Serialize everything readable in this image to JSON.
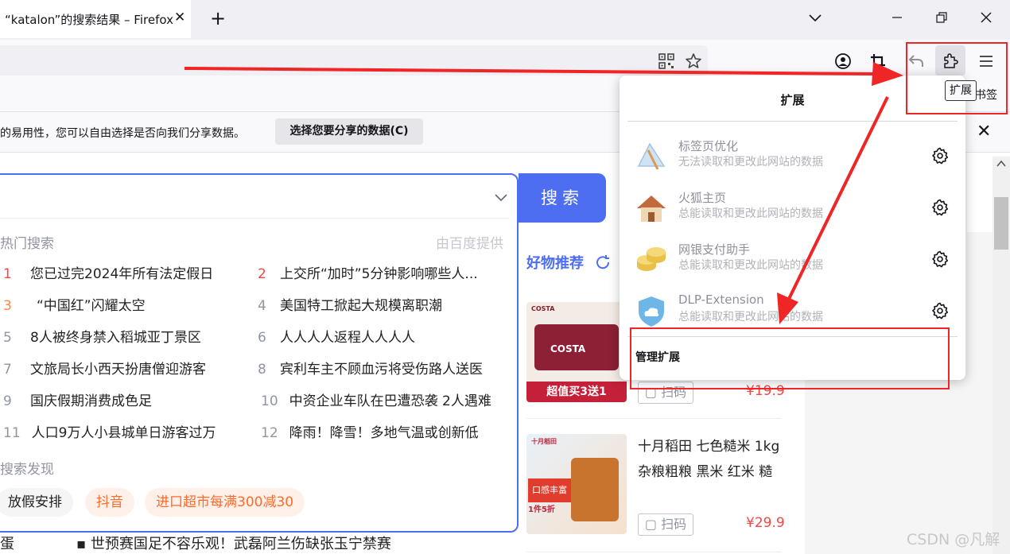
{
  "window": {
    "tab_title": "“katalon”的搜索结果 – Firefox",
    "tab_close": "✕",
    "new_tab": "+"
  },
  "notification": {
    "text": "的易用性，您可以自由选择是否向我们分享数据。",
    "button": "选择您要分享的数据(C)",
    "close": "✕"
  },
  "tooltip": "扩展",
  "bookmarks_label": "书签",
  "extensions_panel": {
    "title": "扩展",
    "items": [
      {
        "name": "标签页优化",
        "permission": "无法读取和更改此网站的数据"
      },
      {
        "name": "火狐主页",
        "permission": "总能读取和更改此网站的数据"
      },
      {
        "name": "网银支付助手",
        "permission": "总能读取和更改此网站的数据"
      },
      {
        "name": "DLP-Extension",
        "permission": "总能读取和更改此网站的数据"
      }
    ],
    "manage": "管理扩展"
  },
  "search": {
    "button": "搜索",
    "hot_title": "热门搜索",
    "hot_source": "由百度提供",
    "hot_items": [
      {
        "num": "1",
        "text": "您已过完2024年所有法定假日"
      },
      {
        "num": "2",
        "text": "上交所“加时”5分钟影响哪些人..."
      },
      {
        "num": "3",
        "text": "“中国红”闪耀太空"
      },
      {
        "num": "4",
        "text": "美国特工掀起大规模离职潮"
      },
      {
        "num": "5",
        "text": "8人被终身禁入稻城亚丁景区"
      },
      {
        "num": "6",
        "text": "人人人人返程人人人人"
      },
      {
        "num": "7",
        "text": "文旅局长小西天扮唐僧迎游客"
      },
      {
        "num": "8",
        "text": "宾利车主不顾血污将受伤路人送医"
      },
      {
        "num": "9",
        "text": "国庆假期消费成色足"
      },
      {
        "num": "10",
        "text": "中资企业车队在巴遭恐袭 2人遇难"
      },
      {
        "num": "11",
        "text": "人口9万人小县城单日游客过万"
      },
      {
        "num": "12",
        "text": "降雨！降雪！多地气温或创新低"
      }
    ],
    "discover_title": "搜索发现",
    "chips": [
      "放假安排",
      "抖音",
      "进口超市每满300减30"
    ]
  },
  "news": {
    "fragment": "蛋",
    "headline": "▪ 世预赛国足不容乐观！武磊阿兰伤缺张玉宁禁赛"
  },
  "goods": {
    "title": "好物推荐",
    "products": [
      {
        "img_label": "COSTA",
        "promo": "超值买3送1",
        "scan": "扫码",
        "price": "¥19.9"
      },
      {
        "name_line1": "十月稻田 七色糙米 1kg",
        "name_line2": "杂粮粗粮 黑米 红米 糙",
        "img_label": "十月稻田",
        "promo": "口感丰富",
        "promo2": "1件5折",
        "scan": "扫码",
        "price": "¥29.9"
      }
    ]
  },
  "watermark": "CSDN @凡解",
  "colors": {
    "accent": "#4e6ef2",
    "annotation": "#f02525",
    "hot_red": "#f54545",
    "hot_orange": "#ff8547"
  }
}
